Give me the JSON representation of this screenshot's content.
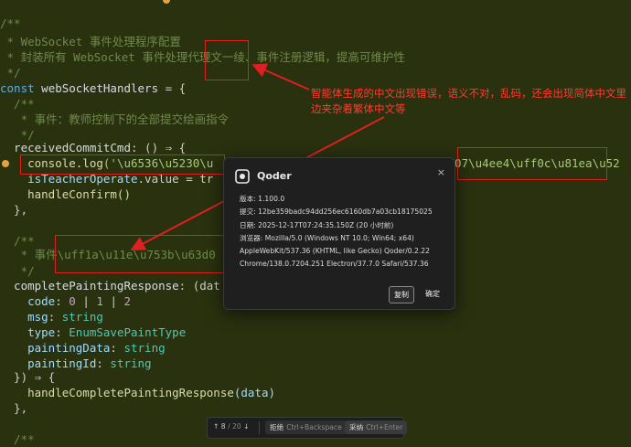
{
  "code": {
    "line1": "/**",
    "line2": " * WebSocket 事件处理程序配置",
    "line3": " * 封装所有 WebSocket 事件处理代理文一绫、事件注册逻辑，提高可维护性",
    "line4": " */",
    "line5_kw": "const",
    "line5_name": "webSocketHandlers",
    "line5_rest": " = {",
    "line6": "  /**",
    "line7": "   * 事件：教师控制下的全部提交绘画指令",
    "line8": "   */",
    "line9_name": "  receivedCommitCmd",
    "line9_rest": ": () ⇒ {",
    "line10_fn": "    console.log",
    "line10_str": "('\\u6536\\u5230\\u",
    "line10_str2": "6307\\u4ee4\\uff0c\\u81ea\\u52",
    "line11_a": "    isTeacherOperate",
    "line11_b": ".value = tr",
    "line12": "    handleConfirm()",
    "line13": "  },",
    "line15": "  /**",
    "line16_a": "   * 事件",
    "line16_b": "\\uff1a\\u11e\\u753b\\u63d0",
    "line17": "   */",
    "line18_name": "  completePaintingResponse",
    "line18_rest": ": (dat",
    "line19_k": "    code",
    "line19_v1": "0",
    "line19_v2": "1",
    "line19_v3": "2",
    "line20_k": "    msg",
    "line20_v": "string",
    "line21_k": "    type",
    "line21_v": "EnumSavePaintType",
    "line22_k": "    paintingData",
    "line22_v": "string",
    "line23_k": "    paintingId",
    "line23_v": "string",
    "line24": "  }) ⇒ {",
    "line25_fn": "    handleCompletePaintingResponse",
    "line25_arg": "(data)",
    "line26": "  },",
    "line28": "  /**"
  },
  "annotation": {
    "text": "智能体生成的中文出现错误，语义不对，乱码，还会出现简体中文里边夹杂着繁体中文等",
    "color": "#ff3b30"
  },
  "dialog": {
    "title": "Qoder",
    "close": "×",
    "version": "版本: 1.100.0",
    "commit": "提交: 12be359badc94dd256ec6160db7a03cb18175025",
    "date": "日期: 2025-12-17T07:24:35.150Z (20 小时前)",
    "browser1": "浏览器: Mozilla/5.0 (Windows NT 10.0; Win64; x64)",
    "browser2": "AppleWebKit/537.36 (KHTML, like Gecko) Qoder/0.2.22",
    "browser3": "Chrome/138.0.7204.251 Electron/37.7.0 Safari/537.36",
    "copy_label": "复制",
    "ok_label": "确定"
  },
  "bottombar": {
    "position": "8",
    "total": "/ 20",
    "reject_label": "拒绝",
    "reject_kbd": "Ctrl+Backspace",
    "accept_label": "采纳",
    "accept_kbd": "Ctrl+Enter"
  },
  "colors": {
    "background": "#29310f",
    "highlight_box": "#e02020",
    "arrow": "#e02020"
  }
}
